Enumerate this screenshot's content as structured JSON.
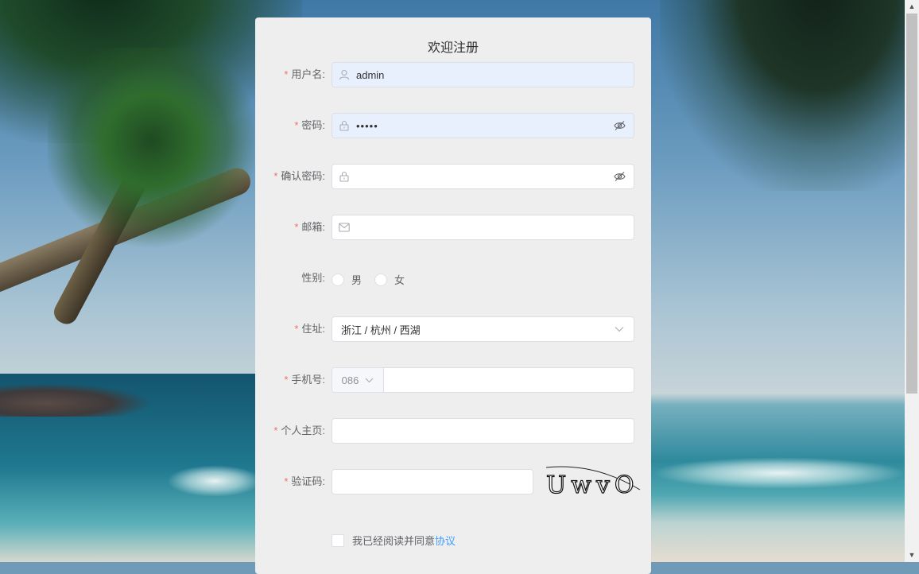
{
  "form": {
    "title": "欢迎注册",
    "required_mark": "*",
    "fields": {
      "username": {
        "label": "用户名:",
        "value": "admin",
        "icon": "user-icon"
      },
      "password": {
        "label": "密码:",
        "value": "•••••",
        "icon": "lock-icon",
        "toggle_icon": "eye-off-icon"
      },
      "confirm_password": {
        "label": "确认密码:",
        "value": "",
        "icon": "lock-icon",
        "toggle_icon": "eye-off-icon"
      },
      "email": {
        "label": "邮箱:",
        "value": "",
        "icon": "mail-icon"
      },
      "gender": {
        "label": "性别:",
        "options": [
          "男",
          "女"
        ]
      },
      "address": {
        "label": "住址:",
        "value": "浙江 / 杭州 / 西湖",
        "icon": "chevron-down-icon"
      },
      "phone": {
        "label": "手机号:",
        "country_code": "086",
        "value": ""
      },
      "homepage": {
        "label": "个人主页:",
        "value": ""
      },
      "captcha": {
        "label": "验证码:",
        "value": "",
        "image_text": "UwvO"
      }
    },
    "agreement": {
      "text": "我已经阅读并同意",
      "link": "协议"
    }
  },
  "colors": {
    "required": "#f56c6c",
    "link": "#409eff",
    "card_bg": "#eeeeee",
    "autofill_bg": "#e8f0fe"
  }
}
